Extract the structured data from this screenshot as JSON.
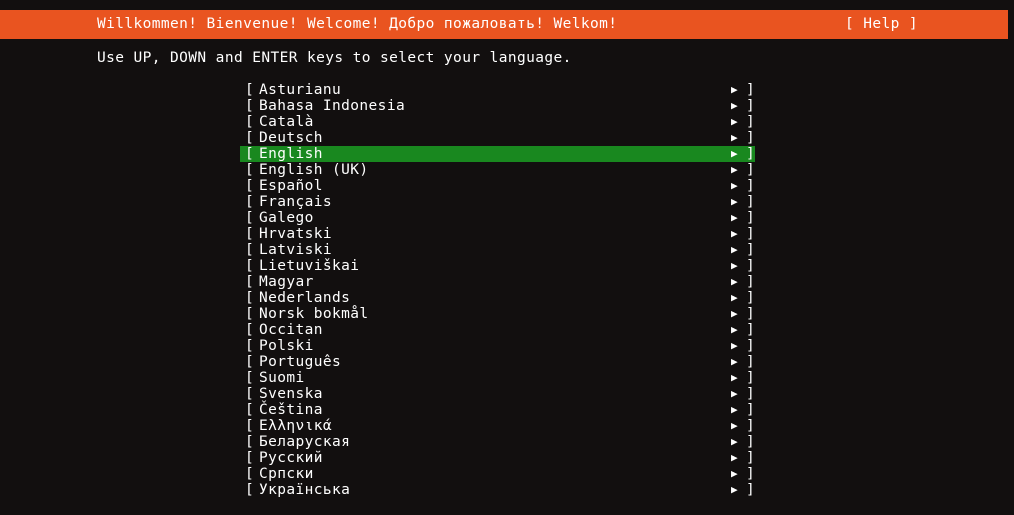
{
  "colors": {
    "background": "#120f0f",
    "banner": "#e95420",
    "selection": "#19881f",
    "text": "#ffffff"
  },
  "banner": {
    "welcome_text": "Willkommen! Bienvenue! Welcome! Добро пожаловать! Welkom!",
    "help_label": "[ Help ]"
  },
  "instruction": "Use UP, DOWN and ENTER keys to select your language.",
  "menu": {
    "bracket_open": "[",
    "bracket_close": "]",
    "arrow_icon": "▶",
    "selected_index": 4,
    "items": [
      {
        "label": "Asturianu"
      },
      {
        "label": "Bahasa Indonesia"
      },
      {
        "label": "Català"
      },
      {
        "label": "Deutsch"
      },
      {
        "label": "English"
      },
      {
        "label": "English (UK)"
      },
      {
        "label": "Español"
      },
      {
        "label": "Français"
      },
      {
        "label": "Galego"
      },
      {
        "label": "Hrvatski"
      },
      {
        "label": "Latviski"
      },
      {
        "label": "Lietuviškai"
      },
      {
        "label": "Magyar"
      },
      {
        "label": "Nederlands"
      },
      {
        "label": "Norsk bokmål"
      },
      {
        "label": "Occitan"
      },
      {
        "label": "Polski"
      },
      {
        "label": "Português"
      },
      {
        "label": "Suomi"
      },
      {
        "label": "Svenska"
      },
      {
        "label": "Čeština"
      },
      {
        "label": "Ελληνικά"
      },
      {
        "label": "Беларуская"
      },
      {
        "label": "Русский"
      },
      {
        "label": "Српски"
      },
      {
        "label": "Українська"
      }
    ]
  }
}
